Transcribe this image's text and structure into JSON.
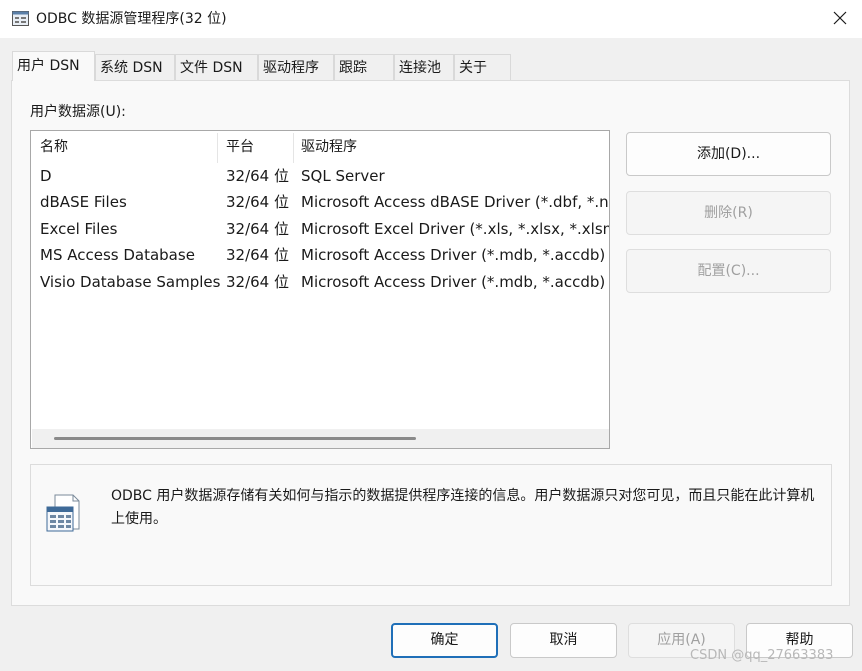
{
  "window": {
    "title": "ODBC 数据源管理程序(32 位)",
    "close_symbol": "✕"
  },
  "tabs": [
    {
      "label": "用户 DSN",
      "active": true
    },
    {
      "label": "系统 DSN"
    },
    {
      "label": "文件 DSN"
    },
    {
      "label": "驱动程序"
    },
    {
      "label": "跟踪"
    },
    {
      "label": "连接池"
    },
    {
      "label": "关于"
    }
  ],
  "list": {
    "title": "用户数据源(U):",
    "columns": [
      "名称",
      "平台",
      "驱动程序"
    ],
    "rows": [
      {
        "name": "D",
        "platform": "32/64 位",
        "driver": "SQL Server"
      },
      {
        "name": "dBASE Files",
        "platform": "32/64 位",
        "driver": "Microsoft Access dBASE Driver (*.dbf, *.nd"
      },
      {
        "name": "Excel Files",
        "platform": "32/64 位",
        "driver": "Microsoft Excel Driver (*.xls, *.xlsx, *.xlsm, *"
      },
      {
        "name": "MS Access Database",
        "platform": "32/64 位",
        "driver": "Microsoft Access Driver (*.mdb, *.accdb)"
      },
      {
        "name": "Visio Database Samples",
        "platform": "32/64 位",
        "driver": "Microsoft Access Driver (*.mdb, *.accdb)"
      }
    ]
  },
  "side_buttons": {
    "add": "添加(D)...",
    "remove": "删除(R)",
    "configure": "配置(C)..."
  },
  "info": {
    "text": "ODBC 用户数据源存储有关如何与指示的数据提供程序连接的信息。用户数据源只对您可见，而且只能在此计算机上使用。"
  },
  "buttons": {
    "ok": "确定",
    "cancel": "取消",
    "apply": "应用(A)",
    "help": "帮助"
  },
  "watermark": "CSDN @qq_27663383",
  "colors": {
    "accent": "#1f6fb8",
    "panel": "#f9f9f9",
    "window_bg": "#f0f0f0"
  }
}
